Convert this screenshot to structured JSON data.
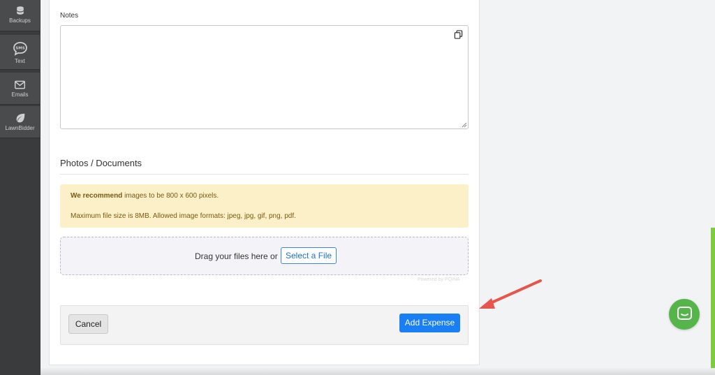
{
  "sidebar": {
    "items": [
      {
        "label": "Backups",
        "icon": "database-icon"
      },
      {
        "label": "Text",
        "icon": "sms-bubble-icon"
      },
      {
        "label": "Emails",
        "icon": "envelope-icon"
      },
      {
        "label": "LawnBidder",
        "icon": "leaf-icon"
      }
    ]
  },
  "notes": {
    "label": "Notes",
    "value": ""
  },
  "photos": {
    "title": "Photos / Documents",
    "alert_bold": "We recommend",
    "alert_line1_rest": " images to be 800 x 600 pixels.",
    "alert_line2": "Maximum file size is 8MB. Allowed image formats: jpeg, jpg, gif, png, pdf.",
    "drop_text": "Drag your files here or",
    "select_file_label": "Select a File",
    "powered_by": "Powered by PQINA"
  },
  "actions": {
    "cancel_label": "Cancel",
    "add_label": "Add Expense"
  },
  "colors": {
    "primary": "#1a7ef5",
    "alert_bg": "#fcf0c9",
    "chat_green": "#55b44a",
    "arrow_red": "#e8554c"
  }
}
